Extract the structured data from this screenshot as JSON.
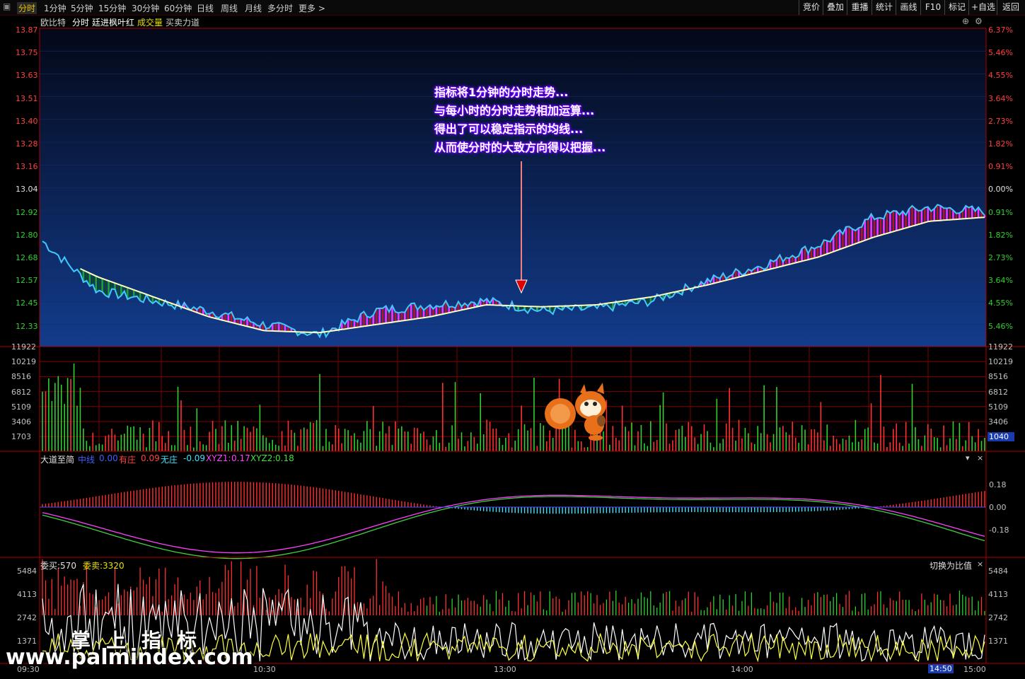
{
  "toolbar": {
    "periods": [
      "分时",
      "1分钟",
      "5分钟",
      "15分钟",
      "30分钟",
      "60分钟",
      "日线",
      "周线",
      "月线",
      "多分时",
      "更多 >"
    ],
    "active": "分时",
    "right": [
      "竞价",
      "叠加",
      "重播",
      "统计",
      "画线",
      "F10",
      "标记",
      "+自选",
      "返回"
    ]
  },
  "main_header": {
    "stock": "欧比特",
    "mode": "分时",
    "indicator": "廷进枫叶红",
    "volume": "成交量",
    "buysell": "买卖力道"
  },
  "price_axis": {
    "left": [
      "13.87",
      "13.75",
      "13.63",
      "13.51",
      "13.40",
      "13.28",
      "13.16",
      "13.04",
      "12.92",
      "12.80",
      "12.68",
      "12.57",
      "12.45",
      "12.33"
    ],
    "right": [
      "6.37%",
      "5.46%",
      "4.55%",
      "3.64%",
      "2.73%",
      "1.82%",
      "0.91%",
      "0.00%",
      "0.91%",
      "1.82%",
      "2.73%",
      "3.64%",
      "4.55%",
      "5.46%"
    ]
  },
  "volume_axis": [
    "11922",
    "10219",
    "8516",
    "6812",
    "5109",
    "3406",
    "1703"
  ],
  "volume_current": "1040",
  "callout": [
    "指标将1分钟的分时走势...",
    "与每小时的分时走势相加运算...",
    "得出了可以稳定指示的均线...",
    "从而使分时的大致方向得以把握..."
  ],
  "dadao": {
    "title": "大道至简",
    "zhong_label": "中线",
    "zhong_val": "0.00",
    "you_label": "有庄",
    "you_val": "0.09",
    "wu_label": "无庄",
    "wu_val": "-0.09",
    "x1_label": "XYZ1:",
    "x1_val": "0.17",
    "x2_label": "XYZ2:",
    "x2_val": "0.18",
    "axis": [
      "0.18",
      "0.00",
      "-0.18"
    ]
  },
  "weituo": {
    "buy": "委买:570",
    "sell": "委卖:3320",
    "switch": "切换为比值",
    "axis": [
      "5484",
      "4113",
      "2742",
      "1371"
    ]
  },
  "time_axis": [
    "09:30",
    "10:30",
    "13:00",
    "14:00",
    "14:50",
    "15:00"
  ],
  "watermark": {
    "cn": "掌上指标",
    "url": "www.palmindex.com"
  },
  "colors": {
    "up": "#ff3030",
    "down": "#30d030",
    "price_line": "#40c8ff",
    "avg_line": "#ffffc0",
    "magenta": "#ff40ff",
    "grid": "#800000"
  },
  "chart_data": {
    "type": "line",
    "title": "",
    "x": [
      "09:30",
      "10:30",
      "13:00",
      "14:00",
      "15:00"
    ],
    "ylim": [
      12.27,
      13.87
    ],
    "series": [
      {
        "values": [
          12.8,
          12.55,
          12.5,
          12.45,
          12.38,
          12.33,
          12.45,
          12.48,
          12.5,
          12.45,
          12.46,
          12.5,
          12.6,
          12.68,
          12.78,
          12.92,
          12.97,
          12.95
        ]
      },
      {
        "values": [
          12.75,
          12.62,
          12.52,
          12.42,
          12.35,
          12.34,
          12.38,
          12.42,
          12.48,
          12.47,
          12.48,
          12.52,
          12.58,
          12.65,
          12.72,
          12.82,
          12.9,
          12.92
        ]
      }
    ]
  }
}
